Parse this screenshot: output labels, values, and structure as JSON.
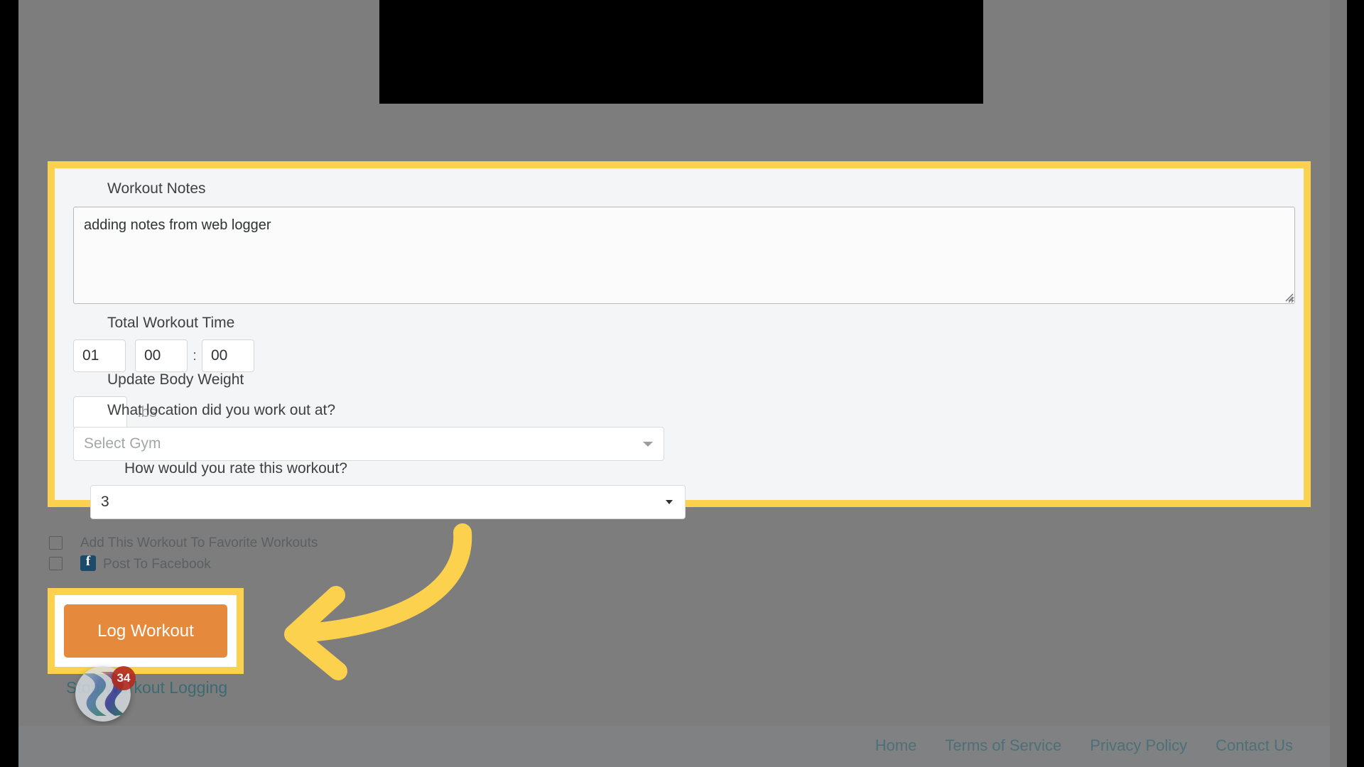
{
  "form": {
    "notes": {
      "label": "Workout Notes",
      "value": "adding notes from web logger"
    },
    "total_time": {
      "label": "Total Workout Time",
      "hours": "01",
      "minutes": "00",
      "separator": ":",
      "seconds": "00"
    },
    "body_weight": {
      "label": "Update Body Weight",
      "value": "",
      "unit": "lbs"
    },
    "location": {
      "label": "What location did you work out at?",
      "value": "Select Gym",
      "is_placeholder": true
    },
    "rating": {
      "label": "How would you rate this workout?",
      "value": "3"
    }
  },
  "options": {
    "favorite": {
      "label": "Add This Workout To Favorite Workouts",
      "checked": false
    },
    "facebook": {
      "label": "Post To Facebook",
      "icon": "facebook-icon",
      "checked": false
    }
  },
  "actions": {
    "log_workout_label": "Log Workout",
    "stop_logging_label": "Stop Workout Logging"
  },
  "chat": {
    "badge_count": "34"
  },
  "footer": {
    "links": [
      {
        "label": "Home"
      },
      {
        "label": "Terms of Service"
      },
      {
        "label": "Privacy Policy"
      },
      {
        "label": "Contact Us"
      }
    ]
  },
  "colors": {
    "highlight": "#fcd14d",
    "button": "#e5893c",
    "page_bg": "#7d7d7d",
    "panel_bg": "#f4f5f7",
    "link": "#3c6a73"
  }
}
